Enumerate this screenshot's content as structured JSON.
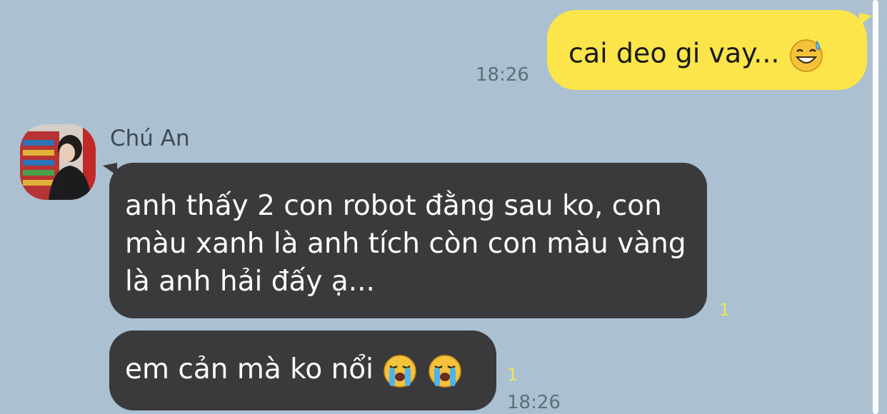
{
  "outgoing": {
    "text": "cai deo gi vay...",
    "emoji_icon": "grinning-sweat-icon",
    "time": "18:26"
  },
  "incoming": {
    "sender": "Chú An",
    "messages": [
      {
        "text": "anh thấy 2 con robot đằng sau ko, con màu xanh là anh tích còn con màu vàng là anh hải đấy ạ...",
        "unread": "1"
      },
      {
        "text": "em cản mà ko nổi",
        "emoji_icons": [
          "loudly-crying-face-icon",
          "loudly-crying-face-icon"
        ],
        "unread": "1",
        "time": "18:26"
      }
    ]
  },
  "colors": {
    "background": "#abc1d1",
    "outgoing_bubble": "#fbe54b",
    "incoming_bubble": "#3a3a3c",
    "unread_count": "#f0e45a"
  }
}
